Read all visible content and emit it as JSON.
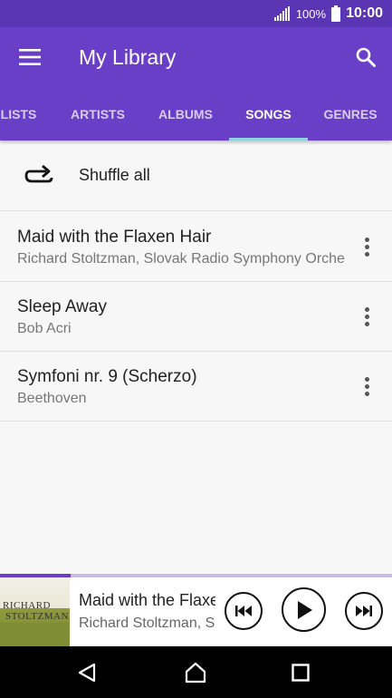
{
  "status_bar": {
    "battery_percent": "100%",
    "time": "10:00",
    "signal_icon": "signal-icon",
    "battery_icon": "battery-icon"
  },
  "app_bar": {
    "title": "My Library",
    "menu_icon": "hamburger-menu-icon",
    "search_icon": "search-icon",
    "background_color": "#6a3fc8"
  },
  "tabs": [
    {
      "label": "LISTS",
      "active": false
    },
    {
      "label": "ARTISTS",
      "active": false
    },
    {
      "label": "ALBUMS",
      "active": false
    },
    {
      "label": "SONGS",
      "active": true
    },
    {
      "label": "GENRES",
      "active": false
    }
  ],
  "shuffle": {
    "label": "Shuffle all",
    "icon": "shuffle-repeat-icon"
  },
  "songs": [
    {
      "title": "Maid with the Flaxen Hair",
      "artist": "Richard Stoltzman, Slovak Radio Symphony Orchestra"
    },
    {
      "title": "Sleep Away",
      "artist": "Bob Acri"
    },
    {
      "title": "Symfoni nr. 9 (Scherzo)",
      "artist": "Beethoven"
    }
  ],
  "now_playing": {
    "title": "Maid with the Flaxen Hair",
    "artist": "Richard Stoltzman, Slovak Radio Symphony Orchestra",
    "album_art_line1": "RICHARD",
    "album_art_line2": "STOLTZMAN",
    "progress": 0.18,
    "controls": {
      "previous_icon": "skip-previous-icon",
      "play_icon": "play-icon",
      "next_icon": "skip-next-icon"
    }
  },
  "nav_bar": {
    "back_icon": "back-icon",
    "home_icon": "home-icon",
    "recents_icon": "recents-icon"
  },
  "colors": {
    "accent": "#6a3fc8",
    "status_bar": "#5a36b5",
    "tab_indicator": "#8fd3e0"
  }
}
